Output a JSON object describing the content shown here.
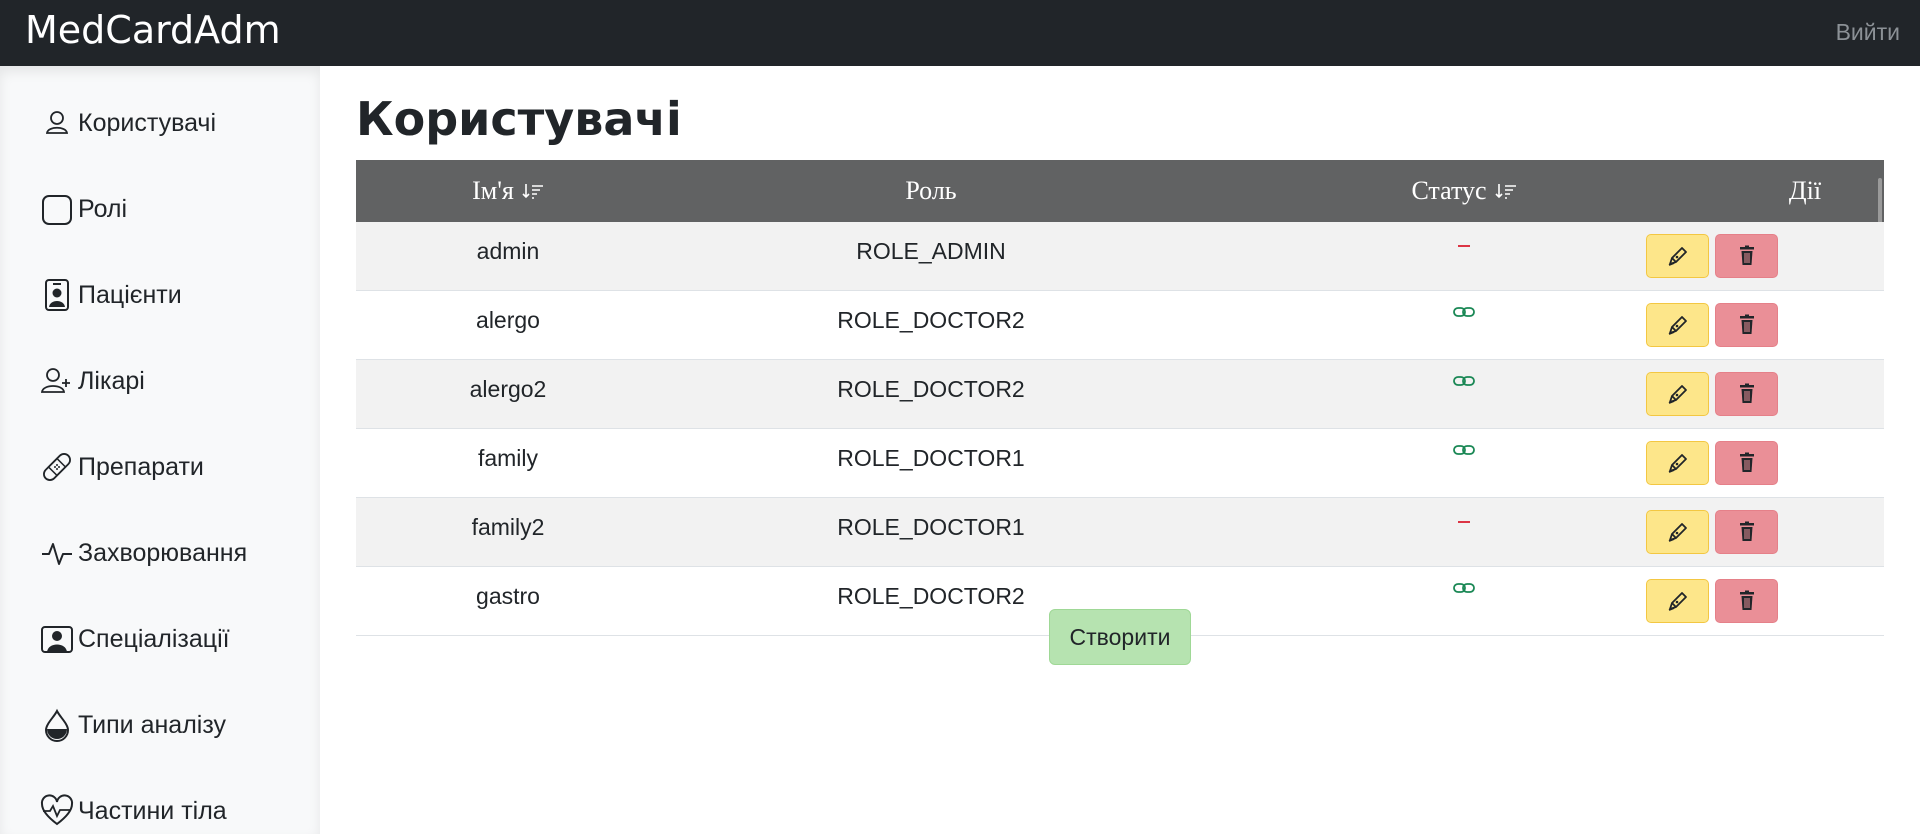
{
  "app": {
    "brand": "MedCardAdm",
    "logout_label": "Вийти"
  },
  "sidebar": {
    "items": [
      {
        "label": "Користувачі",
        "icon": "person-icon"
      },
      {
        "label": "Ролі",
        "icon": "square-icon"
      },
      {
        "label": "Пацієнти",
        "icon": "person-badge-icon"
      },
      {
        "label": "Лікарі",
        "icon": "person-plus-icon"
      },
      {
        "label": "Препарати",
        "icon": "bandaid-icon"
      },
      {
        "label": "Захворювання",
        "icon": "activity-icon"
      },
      {
        "label": "Спеціалізації",
        "icon": "person-square-icon"
      },
      {
        "label": "Типи аналізу",
        "icon": "droplet-half-icon"
      },
      {
        "label": "Частини тіла",
        "icon": "heart-pulse-icon"
      }
    ]
  },
  "page": {
    "title": "Користувачі"
  },
  "table": {
    "columns": [
      "Ім'я",
      "Роль",
      "Статус",
      "Дії"
    ],
    "rows": [
      {
        "name": "admin",
        "role": "ROLE_ADMIN",
        "status": "inactive"
      },
      {
        "name": "alergo",
        "role": "ROLE_DOCTOR2",
        "status": "linked"
      },
      {
        "name": "alergo2",
        "role": "ROLE_DOCTOR2",
        "status": "linked"
      },
      {
        "name": "family",
        "role": "ROLE_DOCTOR1",
        "status": "linked"
      },
      {
        "name": "family2",
        "role": "ROLE_DOCTOR1",
        "status": "inactive"
      },
      {
        "name": "gastro",
        "role": "ROLE_DOCTOR2",
        "status": "linked"
      }
    ]
  },
  "actions": {
    "create_label": "Створити"
  },
  "colors": {
    "navbar": "#212529",
    "table_header": "#616263",
    "edit_button": "#fde68a",
    "delete_button": "#ea8f97",
    "create_button": "#b6e3b0",
    "status_inactive": "#dc3545",
    "status_linked": "#198754"
  }
}
